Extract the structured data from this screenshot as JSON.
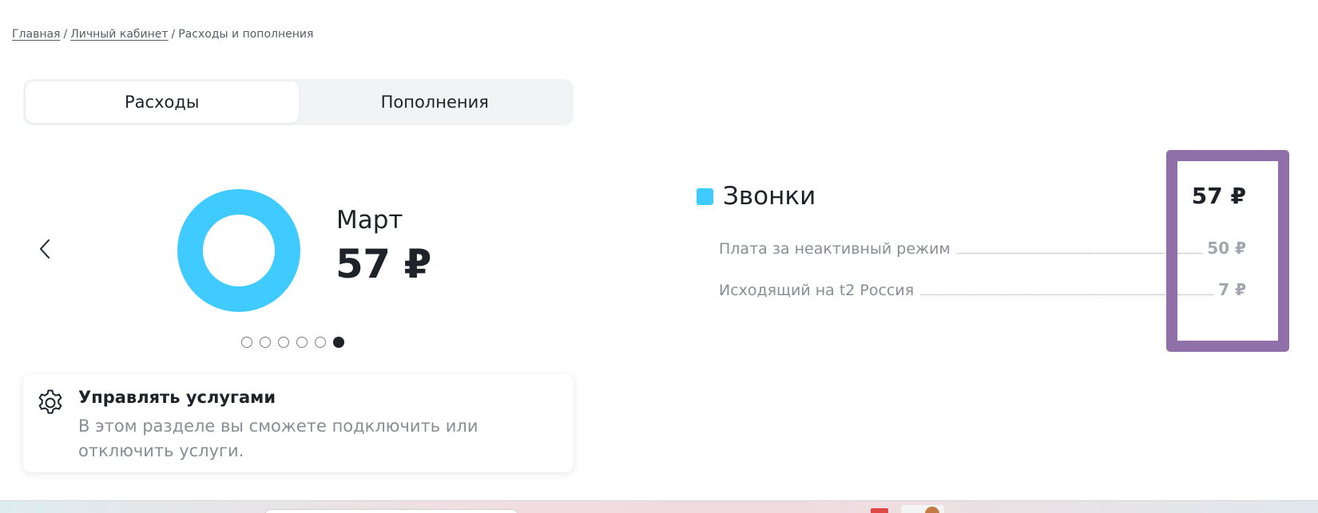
{
  "breadcrumb": {
    "items": [
      "Главная",
      "Личный кабинет"
    ],
    "separator": "/",
    "current": "Расходы и пополнения"
  },
  "tabs": [
    {
      "label": "Расходы",
      "active": true
    },
    {
      "label": "Пополнения",
      "active": false
    }
  ],
  "summary": {
    "month": "Март",
    "total": "57 ₽",
    "donut_color": "#3fcbff",
    "pagination": {
      "count": 6,
      "active_index": 5
    }
  },
  "manage_services": {
    "icon": "gear-icon",
    "title": "Управлять услугами",
    "description": "В этом разделе вы сможете подключить или отключить услуги."
  },
  "breakdown": {
    "category": {
      "name": "Звонки",
      "amount": "57 ₽",
      "color": "#3fcbff"
    },
    "items": [
      {
        "label": "Плата за неактивный режим",
        "amount": "50 ₽"
      },
      {
        "label": "Исходящий на t2 Россия",
        "amount": "7 ₽"
      }
    ]
  },
  "colors": {
    "accent": "#3fcbff",
    "highlight_frame": "#9070a8",
    "text_primary": "#1f2229",
    "text_secondary": "#8a8d96"
  }
}
